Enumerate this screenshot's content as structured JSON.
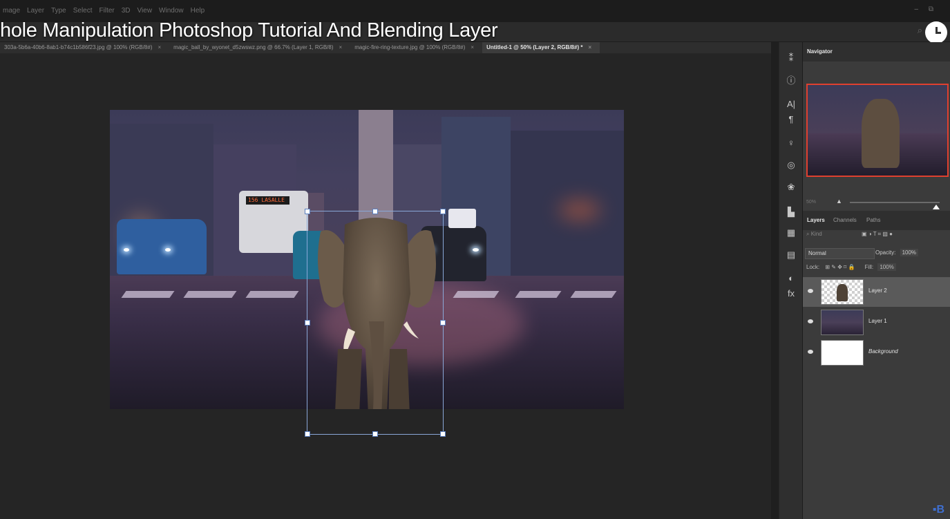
{
  "menu": {
    "items": [
      "mage",
      "Layer",
      "Type",
      "Select",
      "Filter",
      "3D",
      "View",
      "Window",
      "Help"
    ]
  },
  "overlay": {
    "video_title": "hole Manipulation Photoshop Tutorial And Blending Layer",
    "clock_icon": "clock-icon"
  },
  "tabs": [
    {
      "label": "303a-5b6a-40b6-8ab1-b74c1b586f23.jpg @ 100% (RGB/8#)",
      "active": false
    },
    {
      "label": "magic_ball_by_wyonet_d5zwswz.png @ 66.7% (Layer 1, RGB/8)",
      "active": false
    },
    {
      "label": "magic-fire-ring-texture.jpg @ 100% (RGB/8#)",
      "active": false
    },
    {
      "label": "Untitled-1 @ 50% (Layer 2, RGB/8#) *",
      "active": true
    }
  ],
  "bus_sign": "156 LASALLE",
  "dock": {
    "icons": [
      "history-icon",
      "info-icon",
      "character-icon",
      "paragraph-icon",
      "bulb-icon",
      "creative-cloud-icon",
      "libraries-icon",
      "histogram-icon",
      "table-icon",
      "properties-icon",
      "adjustments-icon",
      "styles-icon"
    ]
  },
  "navigator": {
    "tab_label": "Navigator",
    "zoom": "50%"
  },
  "layers_panel": {
    "tabs": [
      "Layers",
      "Channels",
      "Paths"
    ],
    "filter_placeholder": "Kind",
    "blend_mode": "Normal",
    "opacity_label": "Opacity:",
    "opacity_value": "100%",
    "lock_label": "Lock:",
    "fill_label": "Fill:",
    "fill_value": "100%",
    "layers": [
      {
        "name": "Layer 2",
        "selected": true
      },
      {
        "name": "Layer 1",
        "selected": false
      },
      {
        "name": "Background",
        "selected": false
      }
    ]
  },
  "colors": {
    "accent": "#e0402f",
    "transform_box": "#8aa8d8"
  }
}
